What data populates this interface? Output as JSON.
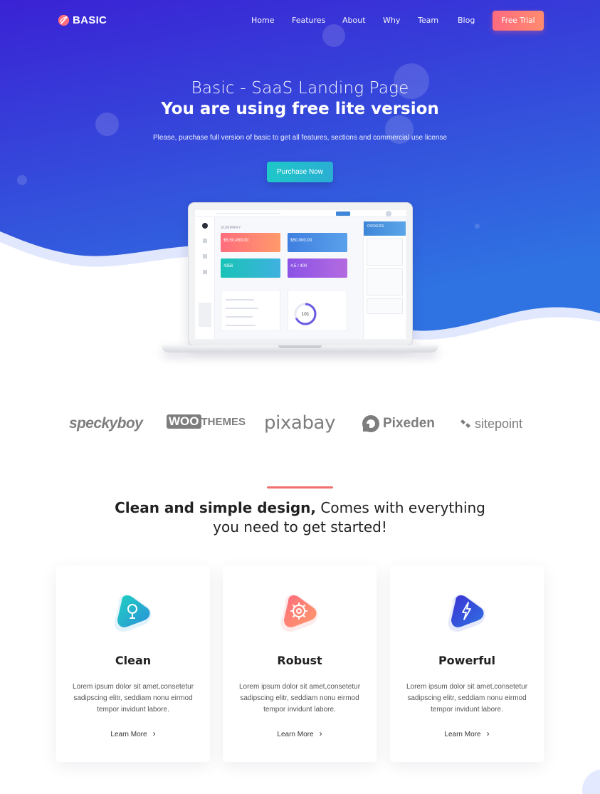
{
  "nav": {
    "logo_text": "BASIC",
    "links": [
      "Home",
      "Features",
      "About",
      "Why",
      "Team",
      "Blog"
    ],
    "cta_label": "Free Trial"
  },
  "hero": {
    "title": "Basic - SaaS Landing Page",
    "subtitle": "You are using free lite version",
    "description": "Please, purchase full version of basic to get all features, sections and commercial use license",
    "button_label": "Purchase Now"
  },
  "brands": [
    "speckyboy",
    "WOO",
    "THEMES",
    "pixabay",
    "Pixeden",
    "sitepoint"
  ],
  "section": {
    "heading_bold": "Clean and simple design,",
    "heading_rest": " Comes with everything you need to get started!"
  },
  "features": [
    {
      "title": "Clean",
      "text": "Lorem ipsum dolor sit amet,consetetur sadipscing elitr, seddiam nonu eirmod tempor invidunt labore.",
      "link": "Learn More",
      "icon": "lightbulb-icon"
    },
    {
      "title": "Robust",
      "text": "Lorem ipsum dolor sit amet,consetetur sadipscing elitr, seddiam nonu eirmod tempor invidunt labore.",
      "link": "Learn More",
      "icon": "gear-icon"
    },
    {
      "title": "Powerful",
      "text": "Lorem ipsum dolor sit amet,consetetur sadipscing elitr, seddiam nonu eirmod tempor invidunt labore.",
      "link": "Learn More",
      "icon": "bolt-icon"
    }
  ],
  "colors": {
    "hero_top": "#3a26d6",
    "hero_bottom": "#2f6de0",
    "cta": "#ff7b79",
    "purchase": "#22bfcb",
    "accent_bar": "#f26d6d"
  },
  "dashboard": {
    "summary_label": "SUMMARY",
    "orders_label": "ORDERS",
    "cards": [
      "$5,50,459.00",
      "$50,000.00",
      "4356",
      "4.5 / 400"
    ],
    "donut_value": "101"
  }
}
